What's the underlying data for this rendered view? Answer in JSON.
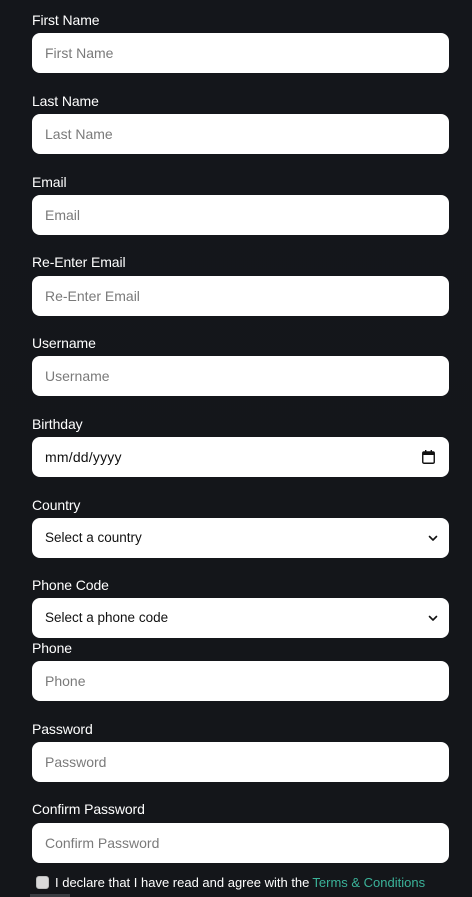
{
  "form": {
    "first_name": {
      "label": "First Name",
      "placeholder": "First Name"
    },
    "last_name": {
      "label": "Last Name",
      "placeholder": "Last Name"
    },
    "email": {
      "label": "Email",
      "placeholder": "Email"
    },
    "re_email": {
      "label": "Re-Enter Email",
      "placeholder": "Re-Enter Email"
    },
    "username": {
      "label": "Username",
      "placeholder": "Username"
    },
    "birthday": {
      "label": "Birthday",
      "value": "mm/dd/yyyy",
      "icon": "calendar-icon"
    },
    "country": {
      "label": "Country",
      "selected": "Select a country",
      "icon": "chevron-down-icon"
    },
    "phone_code": {
      "label": "Phone Code",
      "selected": "Select a phone code",
      "icon": "chevron-down-icon"
    },
    "phone": {
      "label": "Phone",
      "placeholder": "Phone"
    },
    "password": {
      "label": "Password",
      "placeholder": "Password"
    },
    "confirm_password": {
      "label": "Confirm Password",
      "placeholder": "Confirm Password"
    },
    "terms": {
      "declaration": "I declare that I have read and agree with the",
      "link": "Terms & Conditions",
      "checked": false
    }
  },
  "colors": {
    "background": "#14161b",
    "field": "#ffffff",
    "label": "#ffffff",
    "link": "#3bb39a"
  }
}
